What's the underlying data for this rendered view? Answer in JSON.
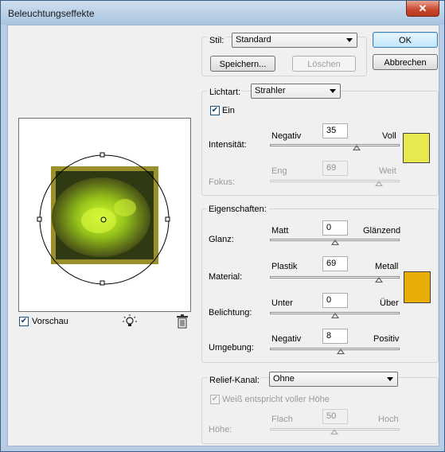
{
  "window": {
    "title": "Beleuchtungseffekte",
    "close_glyph": "✕"
  },
  "buttons": {
    "ok": "OK",
    "cancel": "Abbrechen",
    "save": "Speichern...",
    "delete": "Löschen"
  },
  "style": {
    "label": "Stil:",
    "value": "Standard"
  },
  "light": {
    "type_label": "Lichtart:",
    "type_value": "Strahler",
    "on_label": "Ein",
    "on_checked": true,
    "intensity_label": "Intensität:",
    "intensity_min": "Negativ",
    "intensity_max": "Voll",
    "intensity_value": "35",
    "focus_label": "Fokus:",
    "focus_min": "Eng",
    "focus_max": "Weit",
    "focus_value": "69",
    "color": "#e6ea4e"
  },
  "properties": {
    "header": "Eigenschaften:",
    "gloss_label": "Glanz:",
    "gloss_min": "Matt",
    "gloss_max": "Glänzend",
    "gloss_value": "0",
    "material_label": "Material:",
    "material_min": "Plastik",
    "material_max": "Metall",
    "material_value": "69",
    "exposure_label": "Belichtung:",
    "exposure_min": "Unter",
    "exposure_max": "Über",
    "exposure_value": "0",
    "ambience_label": "Umgebung:",
    "ambience_min": "Negativ",
    "ambience_max": "Positiv",
    "ambience_value": "8",
    "color": "#e8ad06"
  },
  "texture": {
    "channel_label": "Relief-Kanal:",
    "channel_value": "Ohne",
    "white_high_label": "Weiß entspricht voller Höhe",
    "white_high_checked": true,
    "height_label": "Höhe:",
    "height_min": "Flach",
    "height_max": "Hoch",
    "height_value": "50"
  },
  "preview_panel": {
    "preview_label": "Vorschau",
    "preview_checked": true,
    "light_icon": "light-bulb-icon",
    "trash_icon": "trash-icon"
  }
}
